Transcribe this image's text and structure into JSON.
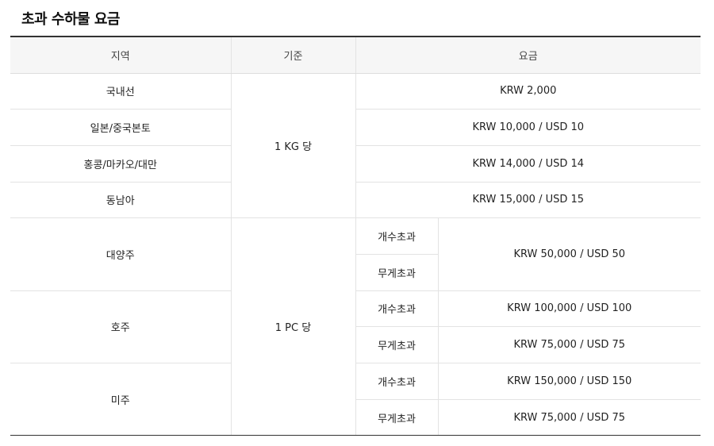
{
  "title": "초과 수하물 요금",
  "headers": {
    "region": "지역",
    "basis": "기준",
    "fee": "요금"
  },
  "basis": {
    "per_kg": "1 KG 당",
    "per_pc": "1 PC 당"
  },
  "kg_rows": [
    {
      "region": "국내선",
      "fee": "KRW 2,000"
    },
    {
      "region": "일본/중국본토",
      "fee": "KRW 10,000 / USD 10"
    },
    {
      "region": "홍콩/마카오/대만",
      "fee": "KRW 14,000 / USD 14"
    },
    {
      "region": "동남아",
      "fee": "KRW 15,000 / USD 15"
    }
  ],
  "pc_groups": [
    {
      "region": "대양주",
      "shared_fee": "KRW 50,000 / USD 50",
      "items": [
        {
          "type": "개수초과"
        },
        {
          "type": "무게초과"
        }
      ]
    },
    {
      "region": "호주",
      "items": [
        {
          "type": "개수초과",
          "fee": "KRW 100,000 / USD 100"
        },
        {
          "type": "무게초과",
          "fee": "KRW 75,000 / USD 75"
        }
      ]
    },
    {
      "region": "미주",
      "items": [
        {
          "type": "개수초과",
          "fee": "KRW 150,000 / USD 150"
        },
        {
          "type": "무게초과",
          "fee": "KRW 75,000 / USD 75"
        }
      ]
    }
  ]
}
